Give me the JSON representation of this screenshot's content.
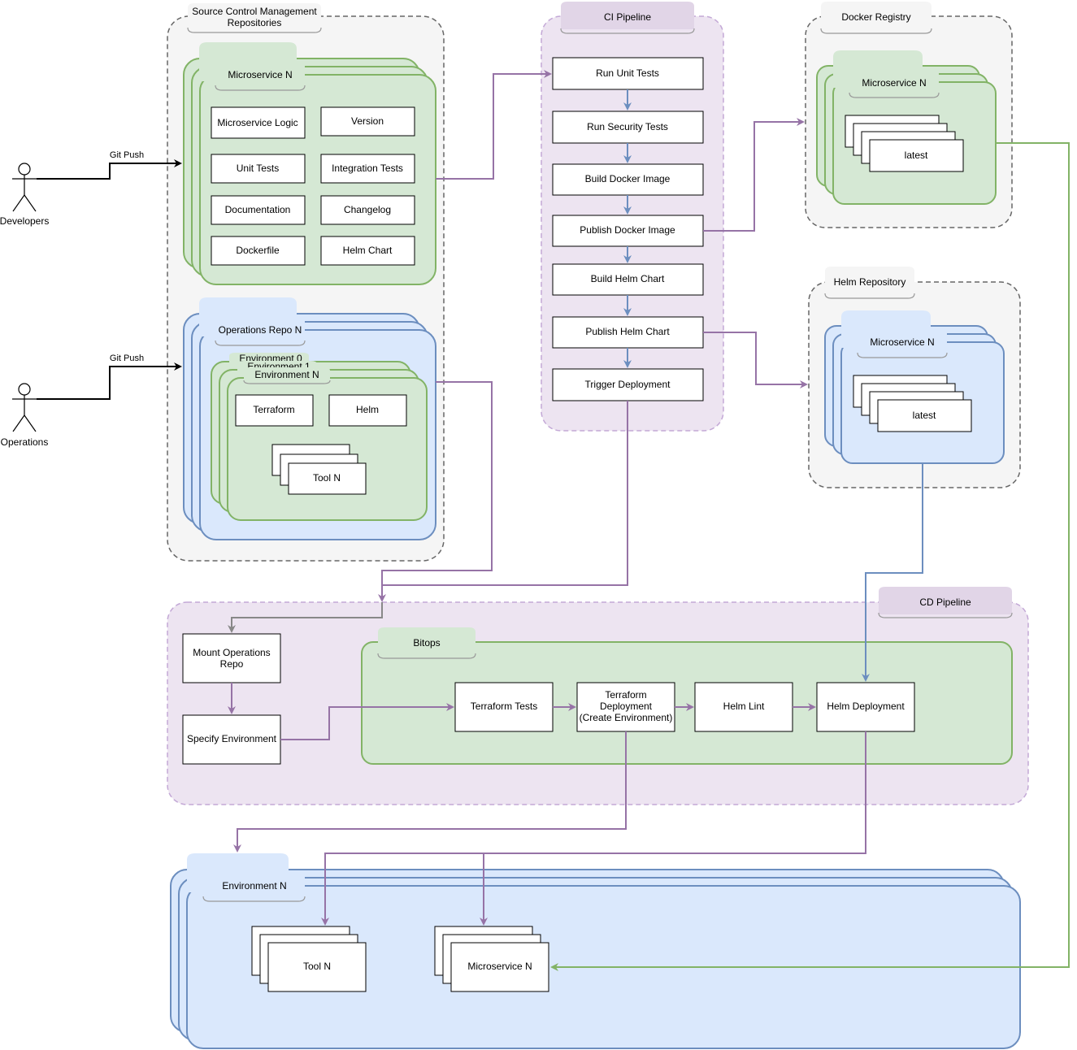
{
  "actors": {
    "developers": "Developers",
    "operations": "Operations"
  },
  "edges": {
    "git_push_dev": "Git Push",
    "git_push_ops": "Git Push"
  },
  "scm": {
    "title": "Source Control Management",
    "title2": "Repositories",
    "microservice": {
      "title": "Microservice N",
      "items": [
        "Microservice Logic",
        "Version",
        "Unit Tests",
        "Integration Tests",
        "Documentation",
        "Changelog",
        "Dockerfile",
        "Helm Chart"
      ]
    },
    "operations_repo": {
      "title": "Operations Repo N",
      "environments": [
        "Environment 0",
        "Environment 1",
        "Environment N"
      ],
      "items": [
        "Terraform",
        "Helm"
      ],
      "tool": "Tool N"
    }
  },
  "ci": {
    "title": "CI Pipeline",
    "steps": [
      "Run Unit Tests",
      "Run Security Tests",
      "Build Docker Image",
      "Publish Docker Image",
      "Build Helm Chart",
      "Publish Helm Chart",
      "Trigger Deployment"
    ]
  },
  "docker_registry": {
    "title": "Docker Registry",
    "microservice": "Microservice N",
    "tag": "latest"
  },
  "helm_repository": {
    "title": "Helm Repository",
    "microservice": "Microservice N",
    "tag": "latest"
  },
  "cd": {
    "title": "CD Pipeline",
    "steps": [
      "Mount Operations",
      "Repo",
      "Specify Environment"
    ],
    "bitops": {
      "title": "Bitops",
      "steps": [
        "Terraform Tests",
        "Terraform",
        "Deployment",
        "(Create Environment)",
        "Helm Lint",
        "Helm Deployment"
      ]
    }
  },
  "environment": {
    "title": "Environment N",
    "tool": "Tool N",
    "microservice": "Microservice N"
  },
  "colors": {
    "green_fill": "#d5e8d4",
    "green_stroke": "#82b366",
    "blue_fill": "#dae8fc",
    "blue_stroke": "#6c8ebf",
    "purple_fill": "#e1d5e7",
    "purple_stroke": "#9673a6",
    "gray_fill": "#f5f5f5"
  }
}
